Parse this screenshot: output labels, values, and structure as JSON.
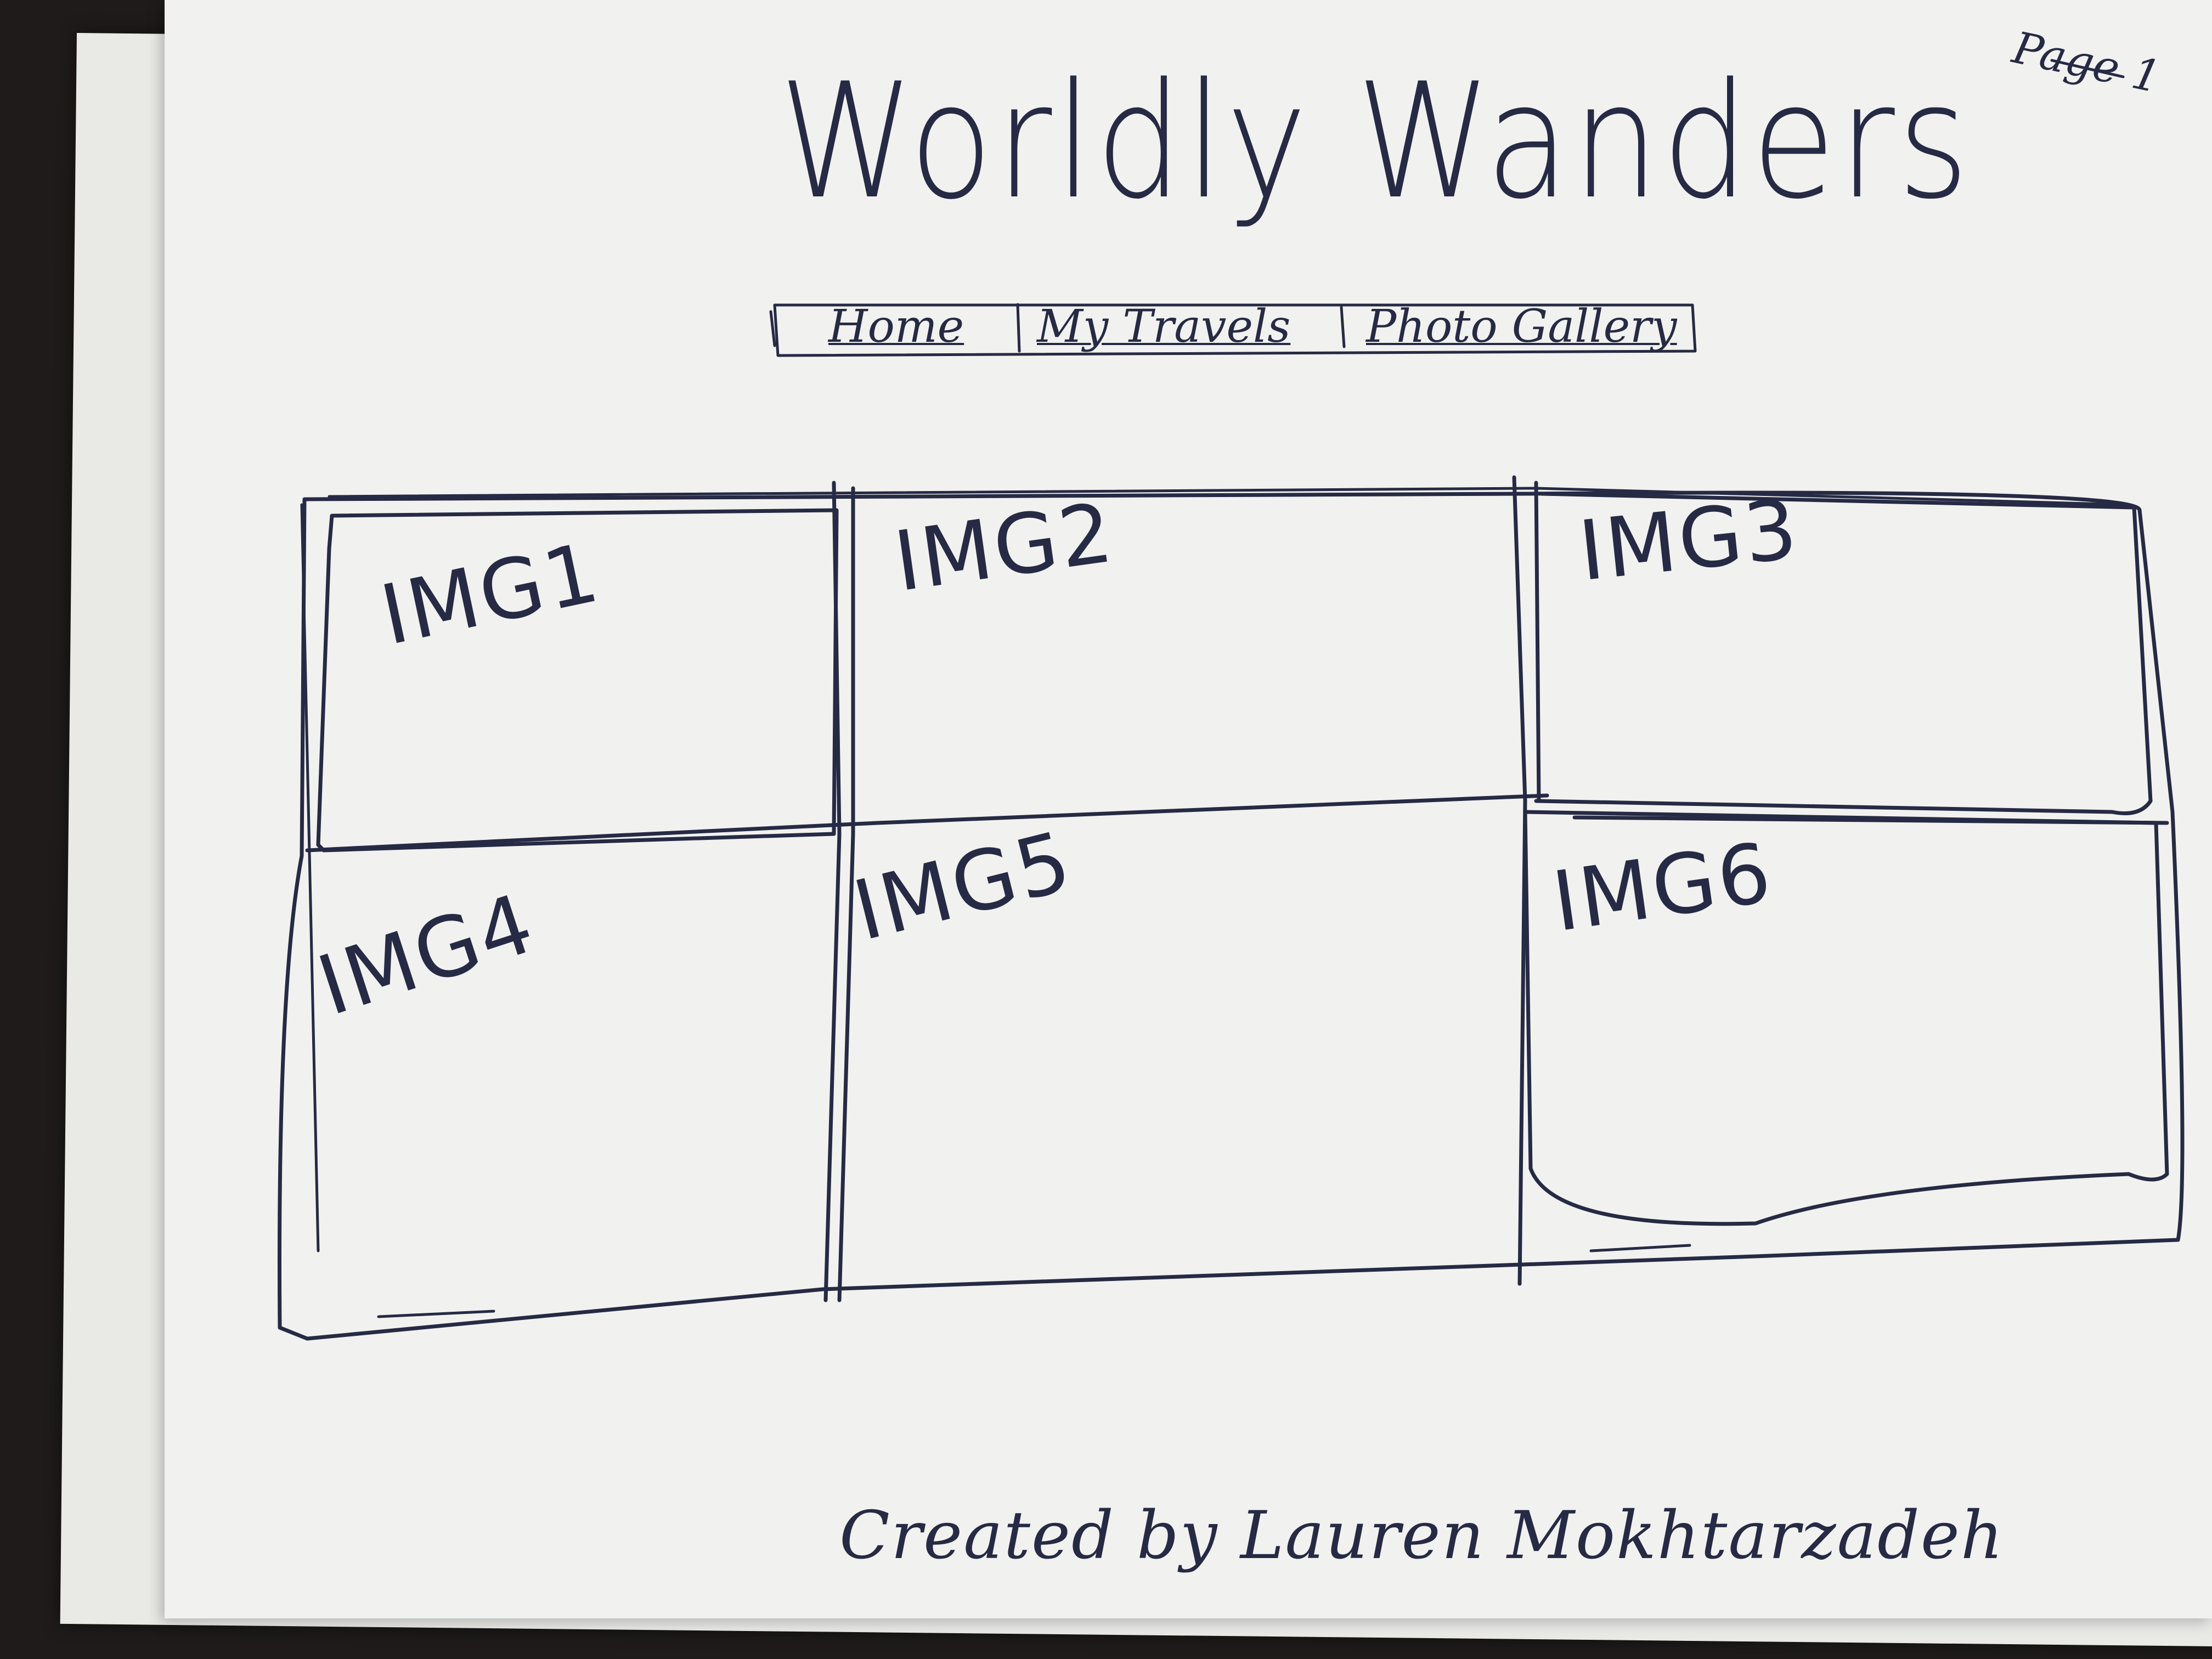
{
  "page_label": "Page 1",
  "site_title": "Worldly Wanders",
  "nav": {
    "items": [
      {
        "label": "Home"
      },
      {
        "label": "My Travels"
      },
      {
        "label": "Photo Gallery"
      }
    ]
  },
  "gallery": {
    "images": [
      {
        "label": "IMG1"
      },
      {
        "label": "IMG2"
      },
      {
        "label": "IMG3"
      },
      {
        "label": "IMG4"
      },
      {
        "label": "IMG5"
      },
      {
        "label": "IMG6"
      }
    ]
  },
  "footer": {
    "credit": "Created by Lauren Mokhtarzadeh"
  },
  "colors": {
    "ink": "#262a44",
    "paper": "#f1f1ef",
    "background": "#1e1b1a"
  }
}
